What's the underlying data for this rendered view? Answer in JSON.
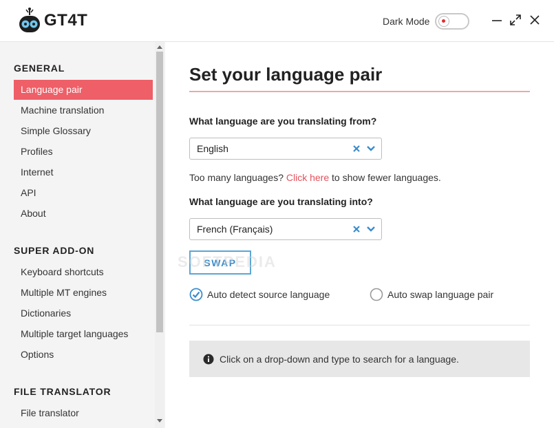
{
  "app": {
    "name": "GT4T"
  },
  "header": {
    "dark_mode_label": "Dark Mode",
    "dark_mode_on": false
  },
  "sidebar": {
    "sections": [
      {
        "title": "GENERAL",
        "items": [
          "Language pair",
          "Machine translation",
          "Simple Glossary",
          "Profiles",
          "Internet",
          "API",
          "About"
        ]
      },
      {
        "title": "SUPER ADD-ON",
        "items": [
          "Keyboard shortcuts",
          "Multiple MT engines",
          "Dictionaries",
          "Multiple target languages",
          "Options"
        ]
      },
      {
        "title": "FILE TRANSLATOR",
        "items": [
          "File translator"
        ]
      }
    ],
    "active_item": "Language pair"
  },
  "main": {
    "title": "Set your language pair",
    "source_question": "What language are you translating from?",
    "source_value": "English",
    "hint_prefix": "Too many languages? ",
    "hint_link": "Click here",
    "hint_suffix": " to show fewer languages.",
    "target_question": "What language are you translating into?",
    "target_value": "French (Français)",
    "swap_label": "SWAP",
    "auto_detect_label": "Auto detect source language",
    "auto_detect_checked": true,
    "auto_swap_label": "Auto swap language pair",
    "auto_swap_checked": false,
    "info_text": "Click on a drop-down and type to search for a language."
  },
  "watermark": "SOFTPEDIA",
  "colors": {
    "accent_red": "#ee5f67",
    "link_red": "#e4505a",
    "accent_blue": "#3a8ccc",
    "sidebar_bg": "#f4f4f4",
    "info_bg": "#e7e7e7"
  },
  "icons": {
    "logo": "robot-icon",
    "minimize": "minimize-icon",
    "maximize": "maximize-icon",
    "close": "close-icon",
    "clear": "clear-x-icon",
    "dropdown": "chevron-down-icon",
    "checked": "check-circle-icon",
    "unchecked": "empty-circle-icon",
    "info": "info-icon"
  }
}
